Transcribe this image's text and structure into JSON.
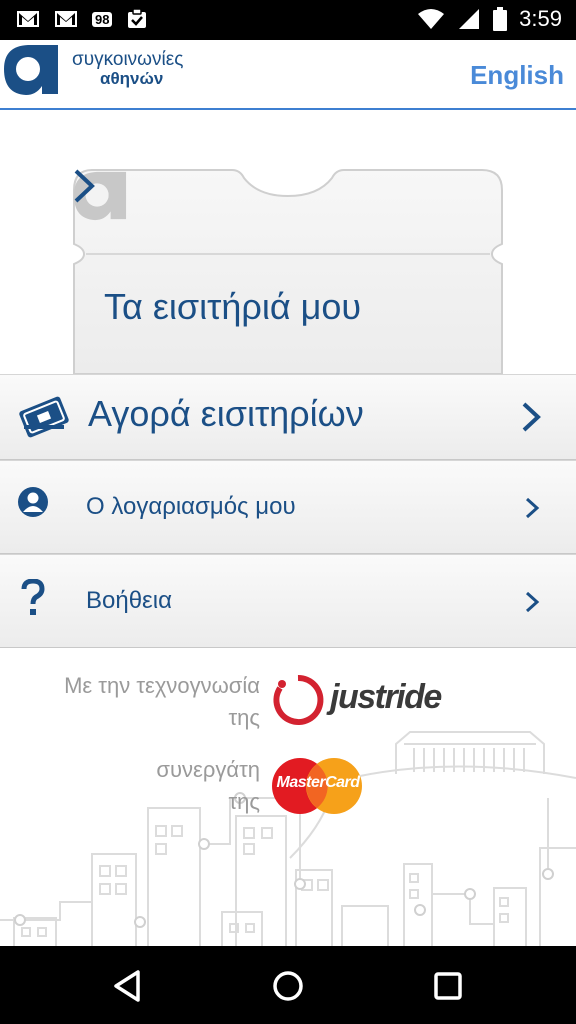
{
  "status_bar": {
    "notification_badge": "98",
    "time": "3:59"
  },
  "header": {
    "brand_line1": "συγκοινωνίες",
    "brand_line2": "αθηνών",
    "language_button": "English"
  },
  "ticket_card": {
    "title": "Τα εισιτήριά μου"
  },
  "menu": {
    "buy": "Αγορά εισιτηρίων",
    "account": "Ο λογαριασμός μου",
    "help": "Βοήθεια"
  },
  "footer": {
    "powered_by": "Με την τεχνογνωσία της",
    "powered_brand": "justride",
    "partner": "συνεργάτη της",
    "partner_brand": "MasterCard"
  },
  "colors": {
    "brand_blue": "#1b4f86",
    "link_blue": "#4a8ad8"
  },
  "icons": [
    "gmail-icon",
    "gmail-icon",
    "clipboard-check-icon",
    "wifi-icon",
    "signal-icon",
    "battery-icon",
    "ticket-icon",
    "user-icon",
    "question-icon",
    "chevron-right-icon",
    "back-icon",
    "home-icon",
    "recents-icon"
  ]
}
